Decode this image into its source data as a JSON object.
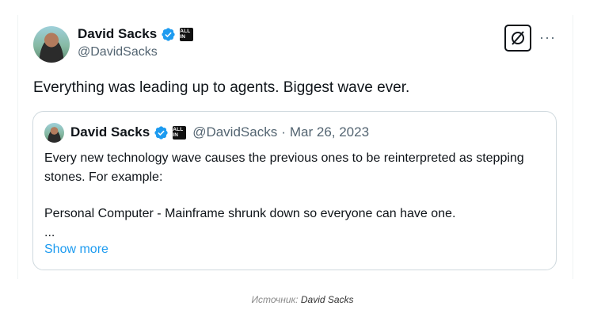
{
  "tweet": {
    "author_name": "David Sacks",
    "handle": "@DavidSacks",
    "badge_text": "ALL IN",
    "text": "Everything was leading up to agents. Biggest wave ever.",
    "more_label": "···"
  },
  "quote": {
    "author_name": "David Sacks",
    "handle": "@DavidSacks",
    "separator": "·",
    "date": "Mar 26, 2023",
    "line1": "Every new technology wave causes the previous ones to be reinterpreted as stepping stones. For example:",
    "line2": "Personal Computer - Mainframe shrunk down so everyone can have one.",
    "ellipsis": "...",
    "show_more": "Show more"
  },
  "caption": {
    "prefix": "Источник:",
    "author": "David Sacks"
  },
  "colors": {
    "verified": "#1d9bf0",
    "link": "#1d9bf0",
    "muted": "#536471"
  },
  "icons": [
    "verified-badge-icon",
    "all-in-badge-icon",
    "grok-icon",
    "more-icon"
  ]
}
